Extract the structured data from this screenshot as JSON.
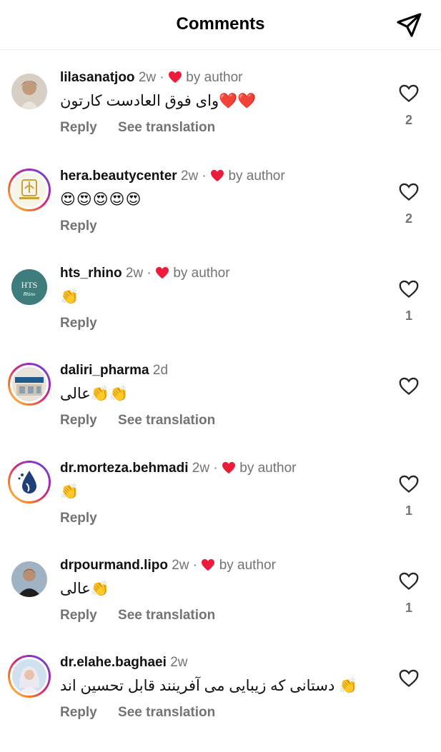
{
  "header": {
    "title": "Comments"
  },
  "labels": {
    "reply": "Reply",
    "see_translation": "See translation",
    "by_author": "by author"
  },
  "colors": {
    "heart": "#ed1c3a",
    "muted": "#737373"
  },
  "comments": [
    {
      "username": "lilasanatjoo",
      "time": "2w ·",
      "liked_by_author": true,
      "text": "وای فوق العادست کارتون❤️❤️",
      "has_translation": true,
      "likes": "2",
      "avatar": "photo-avatar"
    },
    {
      "username": "hera.beautycenter",
      "time": "2w ·",
      "liked_by_author": true,
      "text": "😍😍😍😍😍",
      "has_translation": false,
      "likes": "2",
      "avatar": "logo-avatar"
    },
    {
      "username": "hts_rhino",
      "time": "2w ·",
      "liked_by_author": true,
      "text": "👏",
      "has_translation": false,
      "likes": "1",
      "avatar": "logo-avatar"
    },
    {
      "username": "daliri_pharma",
      "time": "2d",
      "liked_by_author": false,
      "text": "عالی👏👏",
      "has_translation": true,
      "likes": "",
      "avatar": "logo-avatar"
    },
    {
      "username": "dr.morteza.behmadi",
      "time": "2w ·",
      "liked_by_author": true,
      "text": "👏",
      "has_translation": false,
      "likes": "1",
      "avatar": "logo-avatar"
    },
    {
      "username": "drpourmand.lipo",
      "time": "2w ·",
      "liked_by_author": true,
      "text": "عالی👏",
      "has_translation": true,
      "likes": "1",
      "avatar": "photo-avatar"
    },
    {
      "username": "dr.elahe.baghaei",
      "time": "2w",
      "liked_by_author": false,
      "text": "دستانی که زیبایی می آفرینند قابل تحسین اند 👏",
      "has_translation": true,
      "likes": "",
      "avatar": "photo-avatar"
    }
  ],
  "avatar_texts": {
    "hts_line1": "HTS",
    "hts_line2": "Rhino"
  }
}
